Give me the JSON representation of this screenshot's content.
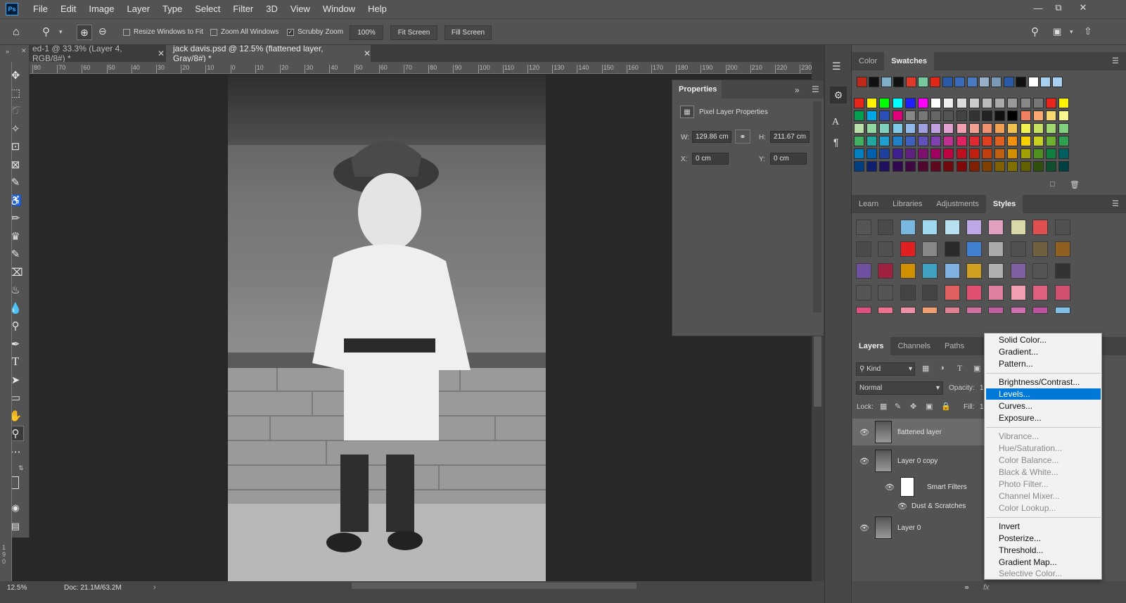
{
  "app": {
    "logo": "Ps"
  },
  "menu": [
    "File",
    "Edit",
    "Image",
    "Layer",
    "Type",
    "Select",
    "Filter",
    "3D",
    "View",
    "Window",
    "Help"
  ],
  "options": {
    "resize_windows": "Resize Windows to Fit",
    "zoom_all": "Zoom All Windows",
    "scrubby": "Scrubby Zoom",
    "zoom_value": "100%",
    "fit_screen": "Fit Screen",
    "fill_screen": "Fill Screen"
  },
  "tabs": [
    {
      "label": "ed-1 @ 33.3% (Layer 4, RGB/8#) *"
    },
    {
      "label": "jack davis.psd @ 12.5% (flattened layer, Gray/8#) *"
    }
  ],
  "ruler": {
    "h": [
      "80",
      "70",
      "60",
      "50",
      "40",
      "30",
      "20",
      "10",
      "0",
      "10",
      "20",
      "30",
      "40",
      "50",
      "60",
      "70",
      "80",
      "90",
      "100",
      "110",
      "120",
      "130",
      "140",
      "150",
      "160",
      "170",
      "180",
      "190",
      "200",
      "210",
      "220",
      "230"
    ],
    "v": [
      "1",
      "9",
      "0"
    ]
  },
  "status": {
    "zoom": "12.5%",
    "doc": "Doc: 21.1M/63.2M"
  },
  "properties": {
    "title": "Properties",
    "subtitle": "Pixel Layer Properties",
    "w_label": "W:",
    "w_value": "129.86 cm",
    "h_label": "H:",
    "h_value": "211.67 cm",
    "x_label": "X:",
    "x_value": "0 cm",
    "y_label": "Y:",
    "y_value": "0 cm"
  },
  "color_panel": {
    "tabs": [
      "Color",
      "Swatches"
    ]
  },
  "styles_panel": {
    "tabs": [
      "Learn",
      "Libraries",
      "Adjustments",
      "Styles"
    ]
  },
  "layers_panel": {
    "tabs": [
      "Layers",
      "Channels",
      "Paths"
    ],
    "kind": "Kind",
    "blend": "Normal",
    "opacity_label": "Opacity:",
    "opacity_value": "1",
    "lock_label": "Lock:",
    "fill_label": "Fill:",
    "fill_value": "1",
    "layers": [
      "flattened layer",
      "Layer 0 copy",
      "Smart Filters",
      "Dust & Scratches",
      "Layer 0"
    ]
  },
  "dropdown": {
    "group1": [
      "Solid Color...",
      "Gradient...",
      "Pattern..."
    ],
    "group2": [
      "Brightness/Contrast...",
      "Levels...",
      "Curves...",
      "Exposure..."
    ],
    "group3": [
      "Vibrance...",
      "Hue/Saturation...",
      "Color Balance...",
      "Black & White...",
      "Photo Filter...",
      "Channel Mixer...",
      "Color Lookup..."
    ],
    "group4": [
      "Invert",
      "Posterize...",
      "Threshold...",
      "Gradient Map...",
      "Selective Color..."
    ]
  },
  "colors": {
    "accent": "#0078d7",
    "panel": "#535353",
    "dark": "#282828"
  }
}
